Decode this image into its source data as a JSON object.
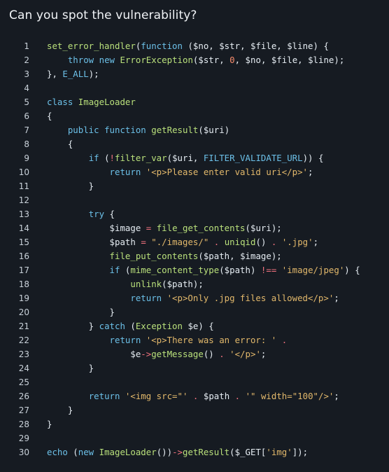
{
  "title": "Can you spot the vulnerability?",
  "colors": {
    "background": "#161b22",
    "keyword": "#6cc0e8",
    "function": "#b9e07b",
    "string": "#e2b86b",
    "operator": "#f0717d",
    "number": "#f78c6c",
    "text": "#e6edf3"
  },
  "code": {
    "language": "php",
    "lines": [
      {
        "n": "1",
        "tokens": [
          [
            "fn",
            "set_error_handler"
          ],
          [
            "pl",
            "("
          ],
          [
            "kw",
            "function"
          ],
          [
            "pl",
            " ("
          ],
          [
            "var",
            "$no"
          ],
          [
            "pl",
            ", "
          ],
          [
            "var",
            "$str"
          ],
          [
            "pl",
            ", "
          ],
          [
            "var",
            "$file"
          ],
          [
            "pl",
            ", "
          ],
          [
            "var",
            "$line"
          ],
          [
            "pl",
            ") {"
          ]
        ]
      },
      {
        "n": "2",
        "tokens": [
          [
            "pl",
            "    "
          ],
          [
            "kw",
            "throw"
          ],
          [
            "pl",
            " "
          ],
          [
            "kw",
            "new"
          ],
          [
            "pl",
            " "
          ],
          [
            "cls",
            "ErrorException"
          ],
          [
            "pl",
            "("
          ],
          [
            "var",
            "$str"
          ],
          [
            "pl",
            ", "
          ],
          [
            "num",
            "0"
          ],
          [
            "pl",
            ", "
          ],
          [
            "var",
            "$no"
          ],
          [
            "pl",
            ", "
          ],
          [
            "var",
            "$file"
          ],
          [
            "pl",
            ", "
          ],
          [
            "var",
            "$line"
          ],
          [
            "pl",
            ");"
          ]
        ]
      },
      {
        "n": "3",
        "tokens": [
          [
            "pl",
            "}, "
          ],
          [
            "const",
            "E_ALL"
          ],
          [
            "pl",
            ");"
          ]
        ]
      },
      {
        "n": "4",
        "tokens": []
      },
      {
        "n": "5",
        "tokens": [
          [
            "kw",
            "class"
          ],
          [
            "pl",
            " "
          ],
          [
            "cls",
            "ImageLoader"
          ]
        ]
      },
      {
        "n": "6",
        "tokens": [
          [
            "pl",
            "{"
          ]
        ]
      },
      {
        "n": "7",
        "tokens": [
          [
            "pl",
            "    "
          ],
          [
            "kw",
            "public"
          ],
          [
            "pl",
            " "
          ],
          [
            "kw",
            "function"
          ],
          [
            "pl",
            " "
          ],
          [
            "fn",
            "getResult"
          ],
          [
            "pl",
            "("
          ],
          [
            "var",
            "$uri"
          ],
          [
            "pl",
            ")"
          ]
        ]
      },
      {
        "n": "8",
        "tokens": [
          [
            "pl",
            "    {"
          ]
        ]
      },
      {
        "n": "9",
        "tokens": [
          [
            "pl",
            "        "
          ],
          [
            "kw",
            "if"
          ],
          [
            "pl",
            " ("
          ],
          [
            "op",
            "!"
          ],
          [
            "fn",
            "filter_var"
          ],
          [
            "pl",
            "("
          ],
          [
            "var",
            "$uri"
          ],
          [
            "pl",
            ", "
          ],
          [
            "const",
            "FILTER_VALIDATE_URL"
          ],
          [
            "pl",
            ")) {"
          ]
        ]
      },
      {
        "n": "10",
        "tokens": [
          [
            "pl",
            "            "
          ],
          [
            "kw",
            "return"
          ],
          [
            "pl",
            " "
          ],
          [
            "str",
            "'<p>Please enter valid uri</p>'"
          ],
          [
            "pl",
            ";"
          ]
        ]
      },
      {
        "n": "11",
        "tokens": [
          [
            "pl",
            "        }"
          ]
        ]
      },
      {
        "n": "12",
        "tokens": []
      },
      {
        "n": "13",
        "tokens": [
          [
            "pl",
            "        "
          ],
          [
            "kw",
            "try"
          ],
          [
            "pl",
            " {"
          ]
        ]
      },
      {
        "n": "14",
        "tokens": [
          [
            "pl",
            "            "
          ],
          [
            "var",
            "$image"
          ],
          [
            "pl",
            " "
          ],
          [
            "op",
            "="
          ],
          [
            "pl",
            " "
          ],
          [
            "fn",
            "file_get_contents"
          ],
          [
            "pl",
            "("
          ],
          [
            "var",
            "$uri"
          ],
          [
            "pl",
            ");"
          ]
        ]
      },
      {
        "n": "15",
        "tokens": [
          [
            "pl",
            "            "
          ],
          [
            "var",
            "$path"
          ],
          [
            "pl",
            " "
          ],
          [
            "op",
            "="
          ],
          [
            "pl",
            " "
          ],
          [
            "str",
            "\"./images/\""
          ],
          [
            "pl",
            " "
          ],
          [
            "op",
            "."
          ],
          [
            "pl",
            " "
          ],
          [
            "fn",
            "uniqid"
          ],
          [
            "pl",
            "() "
          ],
          [
            "op",
            "."
          ],
          [
            "pl",
            " "
          ],
          [
            "str",
            "'.jpg'"
          ],
          [
            "pl",
            ";"
          ]
        ]
      },
      {
        "n": "16",
        "tokens": [
          [
            "pl",
            "            "
          ],
          [
            "fn",
            "file_put_contents"
          ],
          [
            "pl",
            "("
          ],
          [
            "var",
            "$path"
          ],
          [
            "pl",
            ", "
          ],
          [
            "var",
            "$image"
          ],
          [
            "pl",
            ");"
          ]
        ]
      },
      {
        "n": "17",
        "tokens": [
          [
            "pl",
            "            "
          ],
          [
            "kw",
            "if"
          ],
          [
            "pl",
            " ("
          ],
          [
            "fn",
            "mime_content_type"
          ],
          [
            "pl",
            "("
          ],
          [
            "var",
            "$path"
          ],
          [
            "pl",
            ") "
          ],
          [
            "op",
            "!=="
          ],
          [
            "pl",
            " "
          ],
          [
            "str",
            "'image/jpeg'"
          ],
          [
            "pl",
            ") {"
          ]
        ]
      },
      {
        "n": "18",
        "tokens": [
          [
            "pl",
            "                "
          ],
          [
            "fn",
            "unlink"
          ],
          [
            "pl",
            "("
          ],
          [
            "var",
            "$path"
          ],
          [
            "pl",
            ");"
          ]
        ]
      },
      {
        "n": "19",
        "tokens": [
          [
            "pl",
            "                "
          ],
          [
            "kw",
            "return"
          ],
          [
            "pl",
            " "
          ],
          [
            "str",
            "'<p>Only .jpg files allowed</p>'"
          ],
          [
            "pl",
            ";"
          ]
        ]
      },
      {
        "n": "20",
        "tokens": [
          [
            "pl",
            "            }"
          ]
        ]
      },
      {
        "n": "21",
        "tokens": [
          [
            "pl",
            "        } "
          ],
          [
            "kw",
            "catch"
          ],
          [
            "pl",
            " ("
          ],
          [
            "cls",
            "Exception"
          ],
          [
            "pl",
            " "
          ],
          [
            "var",
            "$e"
          ],
          [
            "pl",
            ") {"
          ]
        ]
      },
      {
        "n": "22",
        "tokens": [
          [
            "pl",
            "            "
          ],
          [
            "kw",
            "return"
          ],
          [
            "pl",
            " "
          ],
          [
            "str",
            "'<p>There was an error: '"
          ],
          [
            "pl",
            " "
          ],
          [
            "op",
            "."
          ]
        ]
      },
      {
        "n": "23",
        "tokens": [
          [
            "pl",
            "                "
          ],
          [
            "var",
            "$e"
          ],
          [
            "op",
            "->"
          ],
          [
            "fn",
            "getMessage"
          ],
          [
            "pl",
            "() "
          ],
          [
            "op",
            "."
          ],
          [
            "pl",
            " "
          ],
          [
            "str",
            "'</p>'"
          ],
          [
            "pl",
            ";"
          ]
        ]
      },
      {
        "n": "24",
        "tokens": [
          [
            "pl",
            "        }"
          ]
        ]
      },
      {
        "n": "25",
        "tokens": []
      },
      {
        "n": "26",
        "tokens": [
          [
            "pl",
            "        "
          ],
          [
            "kw",
            "return"
          ],
          [
            "pl",
            " "
          ],
          [
            "str",
            "'<img src=\"'"
          ],
          [
            "pl",
            " "
          ],
          [
            "op",
            "."
          ],
          [
            "pl",
            " "
          ],
          [
            "var",
            "$path"
          ],
          [
            "pl",
            " "
          ],
          [
            "op",
            "."
          ],
          [
            "pl",
            " "
          ],
          [
            "str",
            "'\" width=\"100\"/>'"
          ],
          [
            "pl",
            ";"
          ]
        ]
      },
      {
        "n": "27",
        "tokens": [
          [
            "pl",
            "    }"
          ]
        ]
      },
      {
        "n": "28",
        "tokens": [
          [
            "pl",
            "}"
          ]
        ]
      },
      {
        "n": "29",
        "tokens": []
      },
      {
        "n": "30",
        "tokens": [
          [
            "kw",
            "echo"
          ],
          [
            "pl",
            " ("
          ],
          [
            "kw",
            "new"
          ],
          [
            "pl",
            " "
          ],
          [
            "cls",
            "ImageLoader"
          ],
          [
            "pl",
            "())"
          ],
          [
            "op",
            "->"
          ],
          [
            "fn",
            "getResult"
          ],
          [
            "pl",
            "("
          ],
          [
            "var",
            "$_GET"
          ],
          [
            "pl",
            "["
          ],
          [
            "str",
            "'img'"
          ],
          [
            "pl",
            "]);"
          ]
        ]
      }
    ]
  }
}
